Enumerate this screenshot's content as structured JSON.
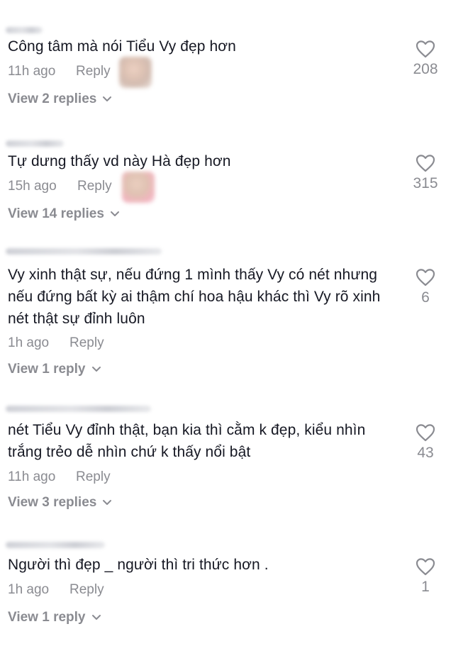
{
  "comments": [
    {
      "text": "Công tâm mà nói Tiểu Vy đẹp hơn",
      "time": "11h ago",
      "reply_label": "Reply",
      "view_replies": "View 2 replies",
      "likes": "208"
    },
    {
      "text": "Tự dưng thấy vd này Hà đẹp hơn",
      "time": "15h ago",
      "reply_label": "Reply",
      "view_replies": "View 14 replies",
      "likes": "315"
    },
    {
      "text": "Vy xinh thật sự, nếu đứng 1 mình thấy Vy có nét nhưng nếu đứng bất kỳ ai thậm chí hoa hậu khác thì Vy rõ xinh nét thật sự đỉnh luôn",
      "time": "1h ago",
      "reply_label": "Reply",
      "view_replies": "View 1 reply",
      "likes": "6"
    },
    {
      "text": "nét Tiểu Vy đỉnh thật, bạn kia thì cằm k đẹp, kiểu nhìn trắng trẻo dễ nhìn chứ k thấy nổi bật",
      "time": "11h ago",
      "reply_label": "Reply",
      "view_replies": "View 3 replies",
      "likes": "43"
    },
    {
      "text": "Người thì đẹp _ người thì tri thức hơn .",
      "time": "1h ago",
      "reply_label": "Reply",
      "view_replies": "View 1 reply",
      "likes": "1"
    }
  ],
  "icons": {
    "like": "heart-outline-icon",
    "expand": "chevron-down-icon"
  },
  "colors": {
    "text": "#161823",
    "muted": "#8a8b91",
    "background": "#ffffff"
  }
}
